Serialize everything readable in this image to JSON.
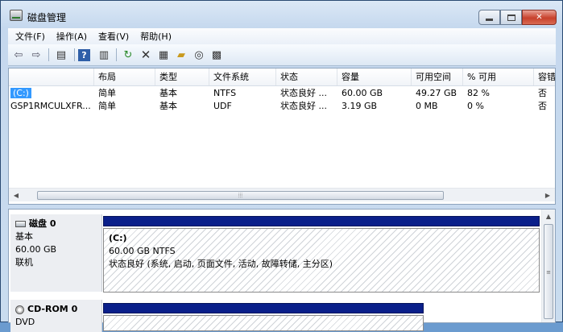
{
  "window": {
    "title": "磁盘管理"
  },
  "menu": [
    "文件(F)",
    "操作(A)",
    "查看(V)",
    "帮助(H)"
  ],
  "toolbar_icons": [
    "back-arrow-icon",
    "forward-arrow-icon",
    "console-tree-icon",
    "help-icon",
    "properties-pane-icon",
    "refresh-icon",
    "delete-icon",
    "properties-icon",
    "open-folder-icon",
    "explore-icon",
    "settings-icon"
  ],
  "table": {
    "columns": [
      "",
      "布局",
      "类型",
      "文件系统",
      "状态",
      "容量",
      "可用空间",
      "% 可用",
      "容错"
    ],
    "rows": [
      {
        "volume": "(C:)",
        "layout": "简单",
        "type": "基本",
        "fs": "NTFS",
        "status": "状态良好 ...",
        "capacity": "60.00 GB",
        "free": "49.27 GB",
        "pct": "82 %",
        "fault": "否"
      },
      {
        "volume": "GSP1RMCULXFR...",
        "layout": "简单",
        "type": "基本",
        "fs": "UDF",
        "status": "状态良好 ...",
        "capacity": "3.19 GB",
        "free": "0 MB",
        "pct": "0 %",
        "fault": "否"
      }
    ]
  },
  "disks": [
    {
      "name": "磁盘 0",
      "kind": "基本",
      "size": "60.00 GB",
      "state": "联机",
      "volume": {
        "name": "(C:)",
        "size_fs": "60.00 GB NTFS",
        "status": "状态良好 (系统, 启动, 页面文件, 活动, 故障转储, 主分区)"
      }
    },
    {
      "name": "CD-ROM 0",
      "kind": "DVD"
    }
  ]
}
